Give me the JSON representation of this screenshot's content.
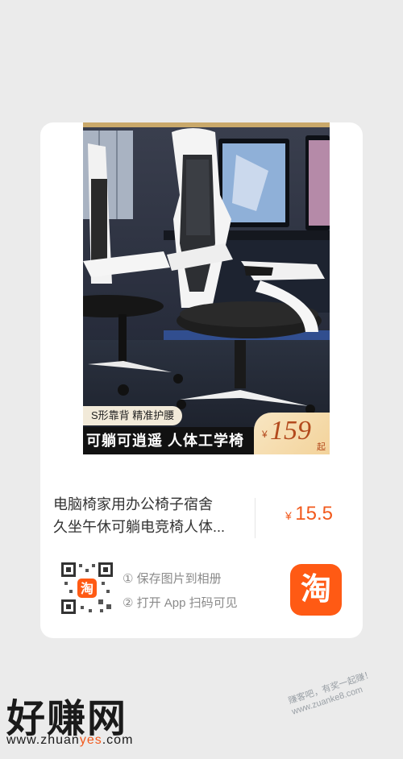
{
  "product": {
    "image_tag": "S形靠背  精准护腰",
    "image_slogan": "可躺可逍遥  人体工学椅",
    "image_price_currency": "¥",
    "image_price_value": "159",
    "image_price_suffix": "起",
    "title_line1": "电脑椅家用办公椅子宿舍",
    "title_line2": "久坐午休可躺电竞椅人体...",
    "price_currency": "¥",
    "price_value": "15.5"
  },
  "share": {
    "qr_center_glyph": "淘",
    "step1": "① 保存图片到相册",
    "step2": "② 打开 App 扫码可见",
    "app_icon_glyph": "淘"
  },
  "watermark": {
    "logo": "好赚网",
    "url_part1": "www.zhuan",
    "url_part2": "yes",
    "url_part3": ".com",
    "slogan_line1": "赚客吧，有奖一起赚！",
    "slogan_line2": "www.zuanke8.com"
  },
  "colors": {
    "accent": "#f25a1d",
    "app_icon": "#ff5a14",
    "background": "#ebebeb"
  }
}
